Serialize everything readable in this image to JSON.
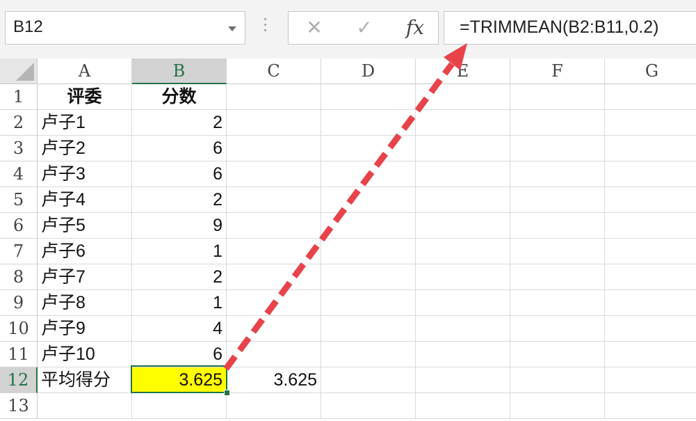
{
  "formula_bar": {
    "name_box": "B12",
    "cancel_glyph": "✕",
    "enter_glyph": "✓",
    "fx_label": "fx",
    "formula": "=TRIMMEAN(B2:B11,0.2)"
  },
  "columns": [
    "A",
    "B",
    "C",
    "D",
    "E",
    "F",
    "G"
  ],
  "rows": [
    "1",
    "2",
    "3",
    "4",
    "5",
    "6",
    "7",
    "8",
    "9",
    "10",
    "11",
    "12",
    "13"
  ],
  "cells": {
    "A1": "评委",
    "B1": "分数",
    "A2": "卢子1",
    "B2": "2",
    "A3": "卢子2",
    "B3": "6",
    "A4": "卢子3",
    "B4": "6",
    "A5": "卢子4",
    "B5": "2",
    "A6": "卢子5",
    "B6": "9",
    "A7": "卢子6",
    "B7": "1",
    "A8": "卢子7",
    "B8": "2",
    "A9": "卢子8",
    "B9": "1",
    "A10": "卢子9",
    "B10": "4",
    "A11": "卢子10",
    "B11": "6",
    "A12": "平均得分",
    "B12": "3.625",
    "C12": "3.625"
  },
  "selected_cell": "B12",
  "colors": {
    "selection": "#217346",
    "highlight_fill": "#ffff00",
    "annotation_arrow": "#e8424a"
  }
}
